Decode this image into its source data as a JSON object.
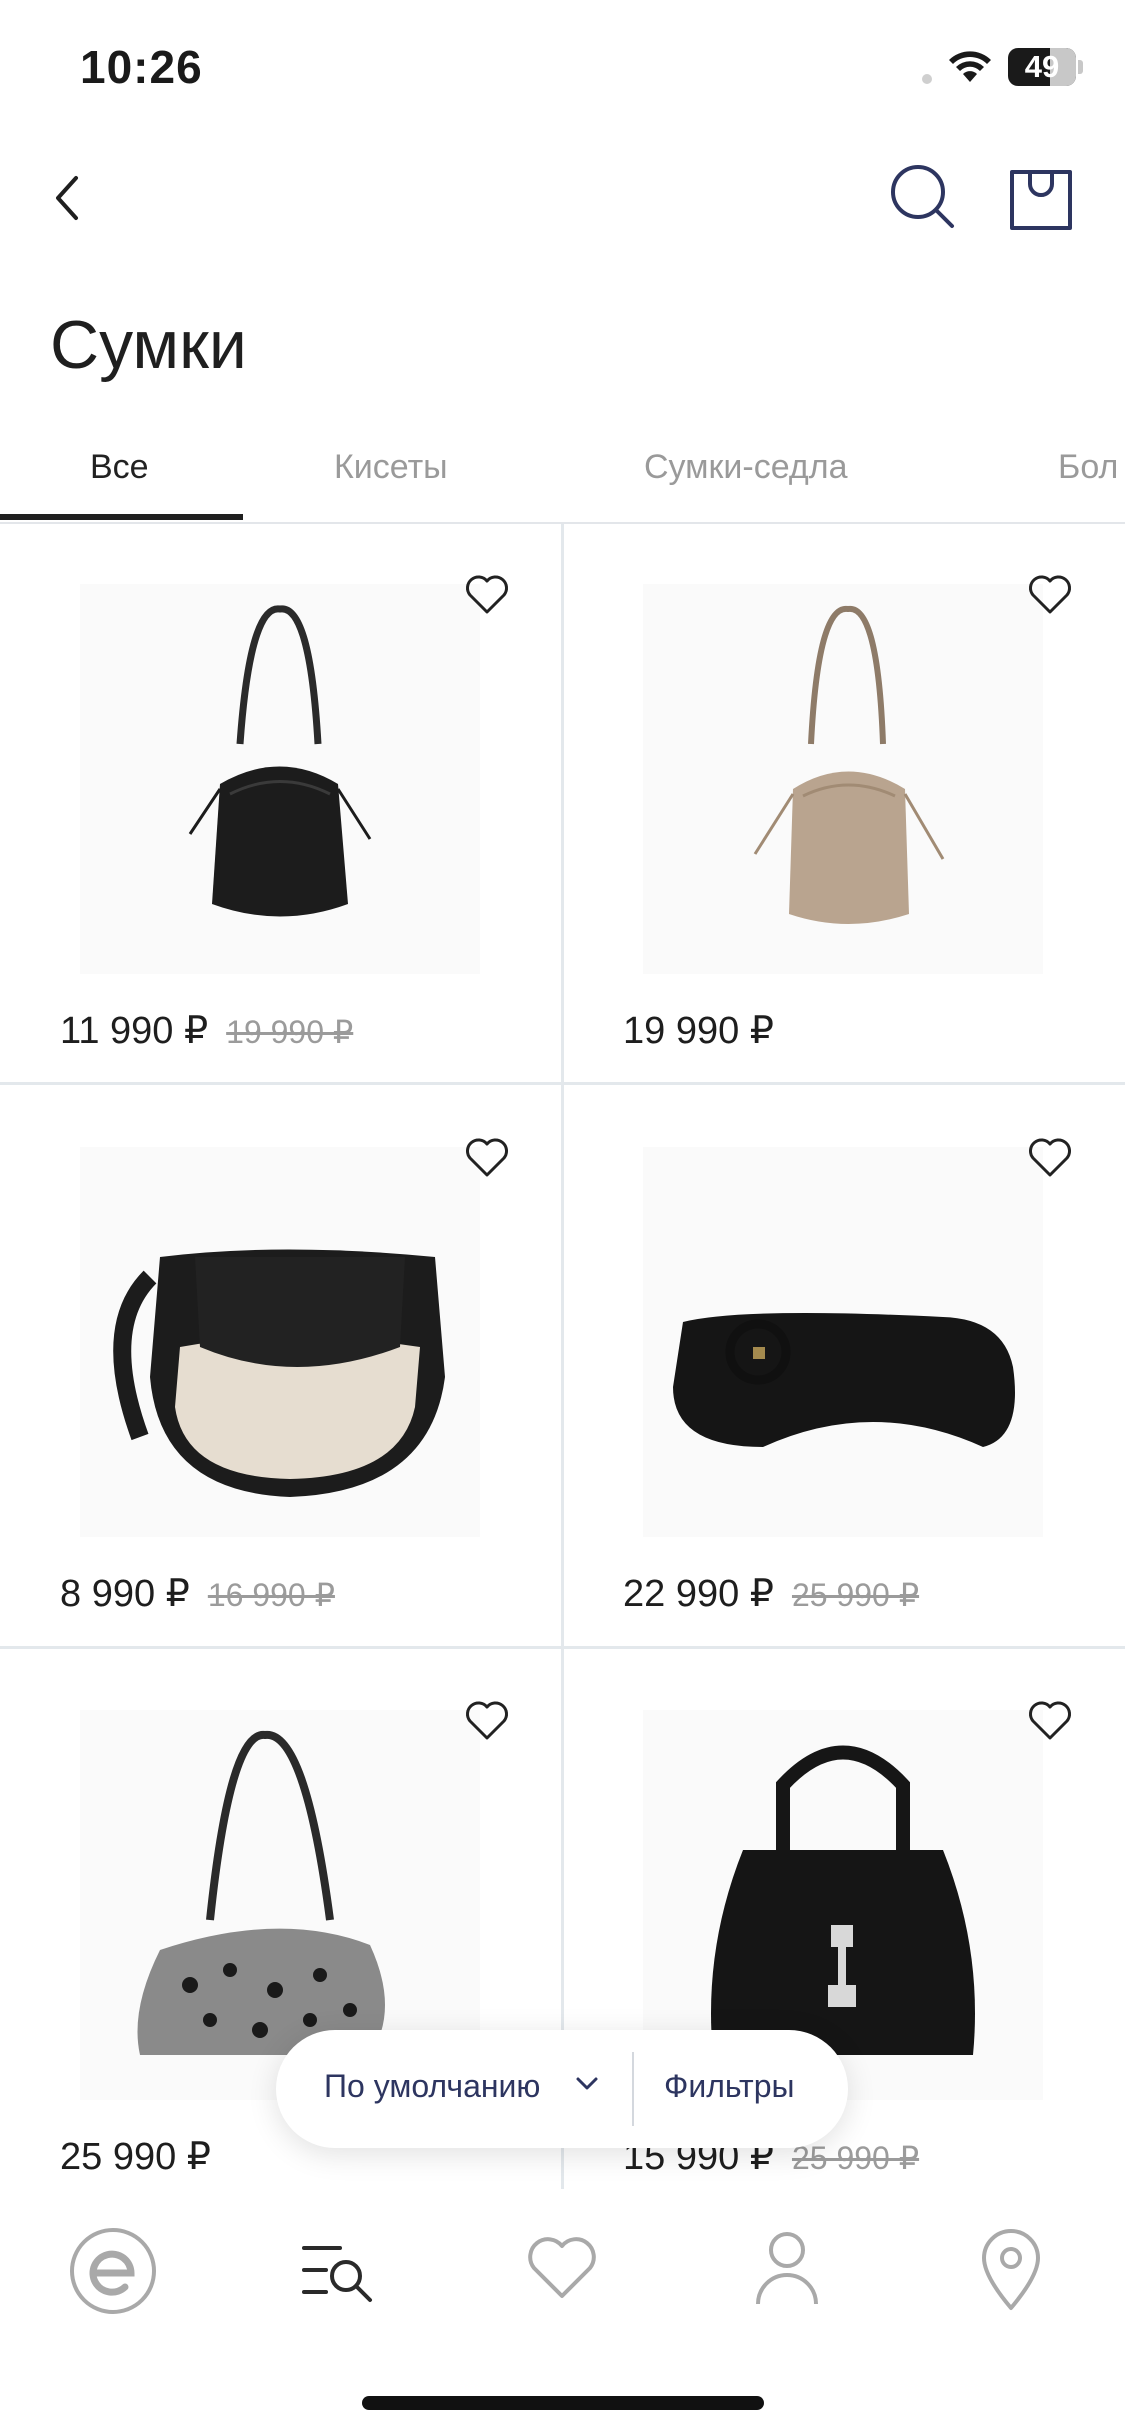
{
  "status": {
    "time": "10:26",
    "battery": "49"
  },
  "header": {
    "title": "Сумки"
  },
  "tabs": [
    {
      "label": "Все",
      "active": true
    },
    {
      "label": "Кисеты",
      "active": false
    },
    {
      "label": "Сумки-седла",
      "active": false
    },
    {
      "label": "Бол",
      "active": false
    }
  ],
  "products": [
    {
      "price": "11 990 ₽",
      "old_price": "19 990 ₽",
      "image": "black-bucket-bag"
    },
    {
      "price": "19 990 ₽",
      "old_price": "",
      "image": "beige-suede-bucket-bag"
    },
    {
      "price": "8 990 ₽",
      "old_price": "16 990 ₽",
      "image": "black-beige-saddle-bag"
    },
    {
      "price": "22 990 ₽",
      "old_price": "25 990 ₽",
      "image": "black-baguette-bag"
    },
    {
      "price": "25 990 ₽",
      "old_price": "",
      "image": "leopard-hobo-bag"
    },
    {
      "price": "15 990 ₽",
      "old_price": "25 990 ₽",
      "image": "black-top-handle-bag"
    }
  ],
  "controls": {
    "sort_label": "По умолчанию",
    "filters_label": "Фильтры"
  },
  "tabbar": [
    "home-logo-icon",
    "catalog-search-icon",
    "favorites-heart-icon",
    "profile-icon",
    "location-pin-icon"
  ]
}
